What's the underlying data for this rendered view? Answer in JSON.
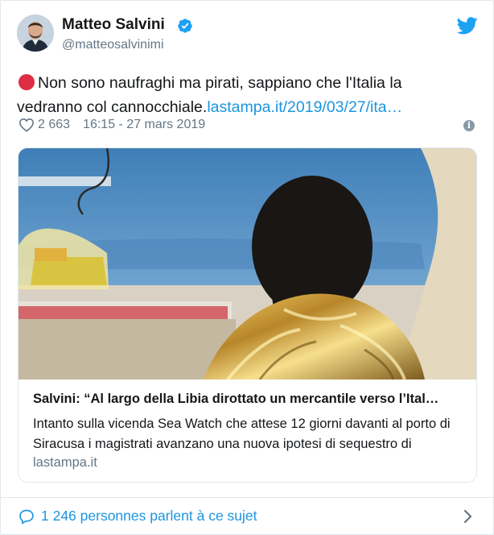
{
  "author": {
    "name": "Matteo Salvini",
    "handle": "@matteosalvinimi",
    "verified_icon": "verified-badge-icon"
  },
  "tweet": {
    "text": "Non sono naufraghi ma pirati, sappiano che l'Italia la vedranno col cannocchiale.",
    "link": "lastampa.it/2019/03/27/ita…",
    "emoji": "red-circle-icon"
  },
  "meta": {
    "likes": "2 663",
    "timestamp": "16:15 - 27 mars 2019"
  },
  "link_card": {
    "title": "Salvini: “Al largo della Libia dirottato un mercantile verso l’Ital…",
    "description": "Intanto sulla vicenda Sea Watch che attese 12 giorni davanti al porto di Siracusa i magistrati avanzano una nuova ipotesi di sequestro di",
    "domain": "lastampa.it"
  },
  "footer": {
    "conversation": "1 246 personnes parlent à ce sujet"
  },
  "colors": {
    "link_blue": "#1b95e0",
    "muted_gray": "#657786",
    "red_dot": "#dd2e44",
    "twitter_blue": "#1da1f2"
  }
}
